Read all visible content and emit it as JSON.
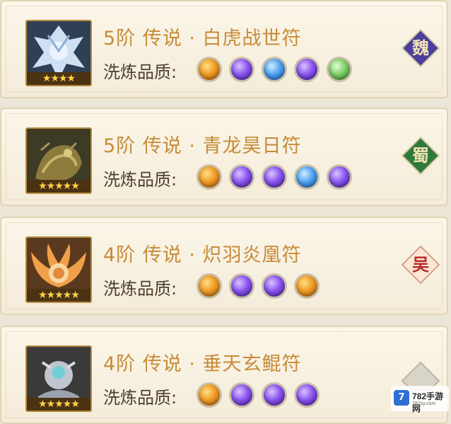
{
  "talismans": [
    {
      "title": "5阶 传说 · 白虎战世符",
      "quality_label": "洗炼品质:",
      "stars": "★★★★",
      "orbs": [
        "orange",
        "purple",
        "blue",
        "purple",
        "green"
      ],
      "faction": "魏",
      "faction_color": "#4a3f9a",
      "portrait_theme": "silver-tiger"
    },
    {
      "title": "5阶 传说 · 青龙昊日符",
      "quality_label": "洗炼品质:",
      "stars": "★★★★★",
      "orbs": [
        "orange",
        "purple",
        "purple",
        "blue",
        "purple"
      ],
      "faction": "蜀",
      "faction_color": "#2f7a3a",
      "portrait_theme": "bronze-dragon"
    },
    {
      "title": "4阶 传说 · 炽羽炎凰符",
      "quality_label": "洗炼品质:",
      "stars": "★★★★★",
      "orbs": [
        "orange",
        "purple",
        "purple",
        "orange"
      ],
      "faction": "吴",
      "faction_color": "#b8262a",
      "portrait_theme": "flame-phoenix"
    },
    {
      "title": "4阶 传说 · 垂天玄鲲符",
      "quality_label": "洗炼品质:",
      "stars": "★★★★★",
      "orbs": [
        "orange",
        "purple",
        "purple",
        "purple"
      ],
      "faction": "",
      "faction_color": "#8a8a8a",
      "portrait_theme": "dark-kun"
    }
  ],
  "watermark": {
    "logo": "7",
    "text": "782手游网",
    "url": "782sy.com"
  }
}
